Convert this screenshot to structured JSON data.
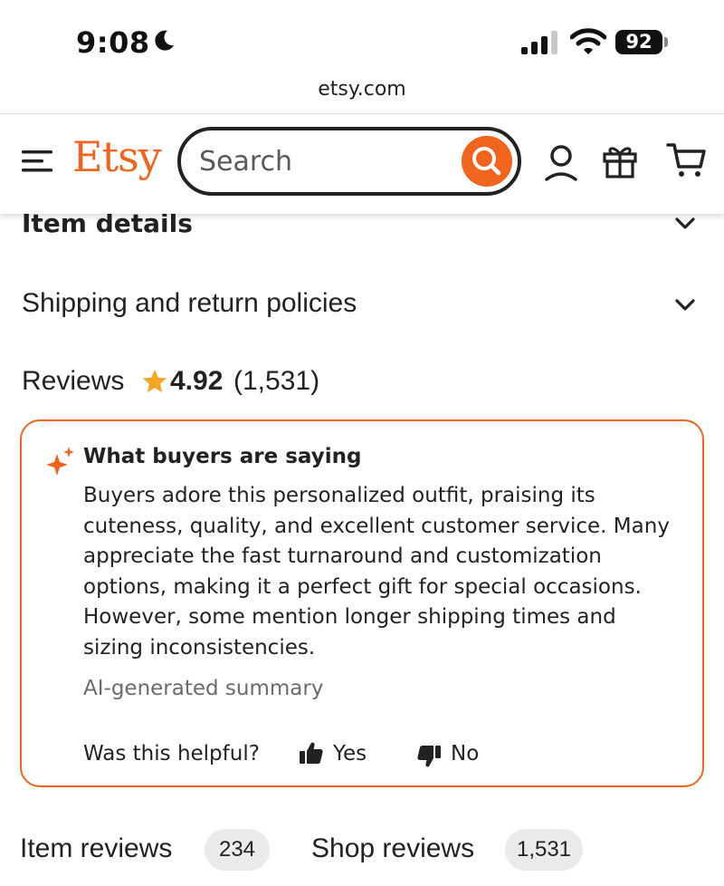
{
  "status_bar": {
    "time": "9:08",
    "battery": "92"
  },
  "browser": {
    "url": "etsy.com"
  },
  "header": {
    "logo": "Etsy",
    "search_placeholder": "Search",
    "accent_color": "#f1641e"
  },
  "sections": {
    "item_details": "Item details",
    "shipping": "Shipping and return policies"
  },
  "reviews": {
    "title": "Reviews",
    "rating": "4.92",
    "count": "(1,531)",
    "star_color": "#f5a623"
  },
  "summary": {
    "title": "What buyers are saying",
    "lines": [
      "Buyers adore this personalized outfit, praising its",
      "cuteness, quality, and excellent customer service. Many",
      "appreciate the fast turnaround and customization",
      "options, making it a perfect gift for special occasions.",
      "However, some mention longer shipping times and",
      "sizing inconsistencies."
    ],
    "note": "AI-generated summary",
    "helpful_prompt": "Was this helpful?",
    "yes_label": "Yes",
    "no_label": "No"
  },
  "tabs": {
    "item_reviews_label": "Item reviews",
    "item_reviews_count": "234",
    "shop_reviews_label": "Shop reviews",
    "shop_reviews_count": "1,531"
  }
}
